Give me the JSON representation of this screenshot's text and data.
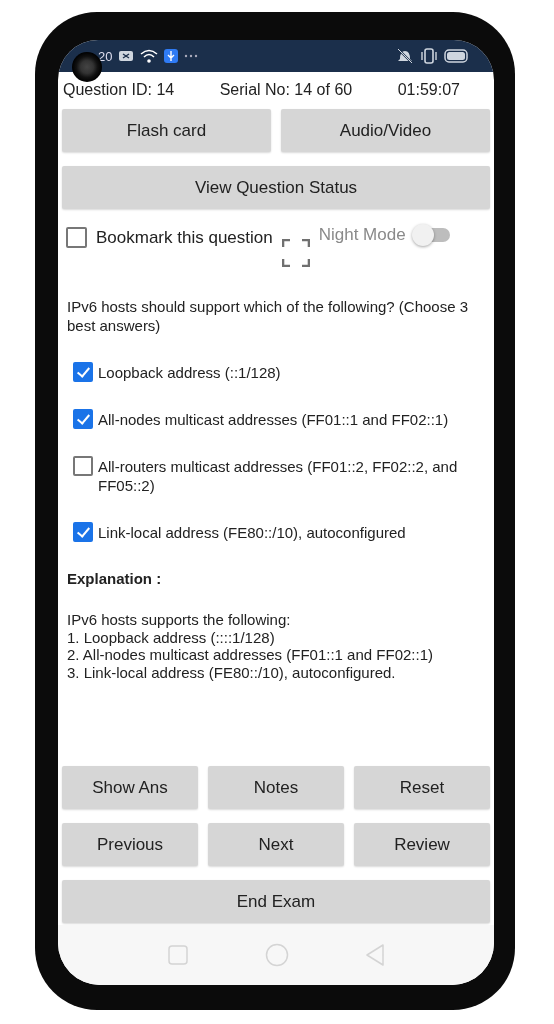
{
  "status_bar": {
    "time": "20"
  },
  "header": {
    "question_id": "Question ID: 14",
    "serial": "Serial No: 14 of 60",
    "timer": "01:59:07"
  },
  "top_buttons": [
    "Flash card",
    "Audio/Video"
  ],
  "status_button": "View Question Status",
  "bookmark": {
    "label": "Bookmark this question",
    "checked": false
  },
  "night_mode": {
    "label": "Night Mode",
    "on": false
  },
  "question": "IPv6 hosts should support which of the following? (Choose 3 best answers)",
  "options": [
    {
      "label": "Loopback address (::1/128)",
      "checked": true
    },
    {
      "label": "All-nodes multicast addresses (FF01::1 and FF02::1)",
      "checked": true
    },
    {
      "label": "All-routers multicast addresses (FF01::2, FF02::2, and FF05::2)",
      "checked": false
    },
    {
      "label": "Link-local address (FE80::/10), autoconfigured",
      "checked": true
    }
  ],
  "explanation": {
    "heading": "Explanation :",
    "lines": [
      "IPv6 hosts supports the following:",
      "1. Loopback address (::::1/128)",
      "2. All-nodes multicast addresses (FF01::1 and FF02::1)",
      "3. Link-local address (FE80::/10), autoconfigured."
    ]
  },
  "action_rows": [
    [
      "Show Ans",
      "Notes",
      "Reset"
    ],
    [
      "Previous",
      "Next",
      "Review"
    ],
    [
      "End Exam"
    ]
  ]
}
